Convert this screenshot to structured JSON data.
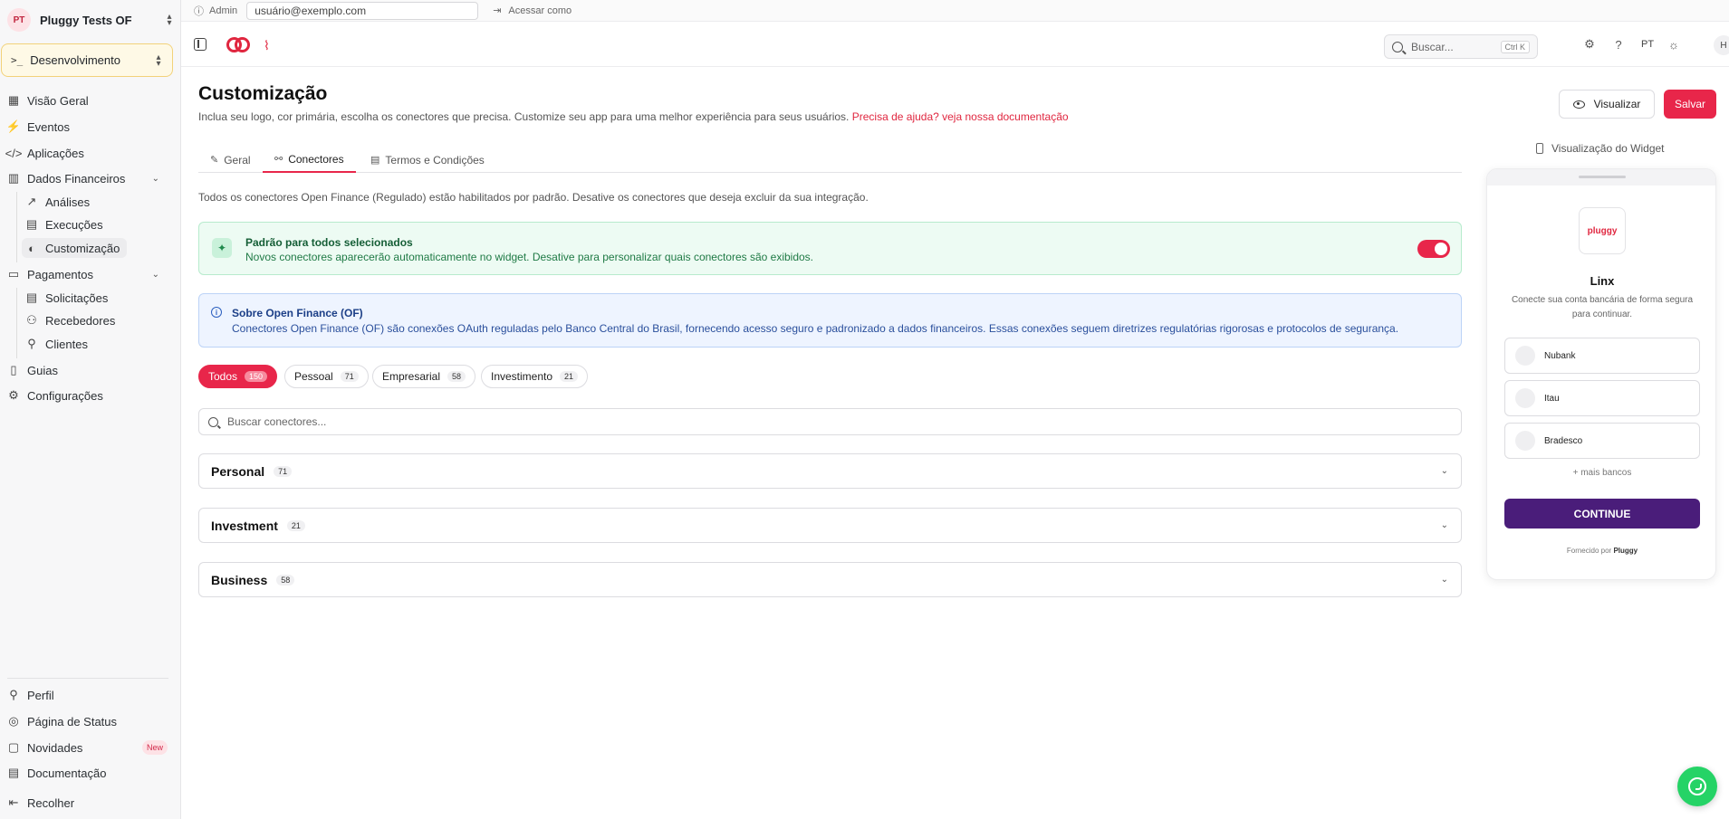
{
  "org": {
    "initials": "PT",
    "name": "Pluggy Tests OF"
  },
  "environment": {
    "prompt": ">_",
    "label": "Desenvolvimento"
  },
  "sidebar": {
    "items": [
      {
        "label": "Visão Geral"
      },
      {
        "label": "Eventos"
      },
      {
        "label": "Aplicações"
      },
      {
        "label": "Dados Financeiros"
      },
      {
        "label": "Análises"
      },
      {
        "label": "Execuções"
      },
      {
        "label": "Customização"
      },
      {
        "label": "Pagamentos"
      },
      {
        "label": "Solicitações"
      },
      {
        "label": "Recebedores"
      },
      {
        "label": "Clientes"
      },
      {
        "label": "Guias"
      },
      {
        "label": "Configurações"
      }
    ],
    "footer": [
      {
        "label": "Perfil"
      },
      {
        "label": "Página de Status"
      },
      {
        "label": "Novidades",
        "badge": "New"
      },
      {
        "label": "Documentação"
      },
      {
        "label": "Recolher"
      }
    ]
  },
  "topbar": {
    "admin_label": "Admin",
    "email_value": "usuário@exemplo.com",
    "impersonate_label": "Acessar como"
  },
  "header": {
    "search_placeholder": "Buscar...",
    "search_shortcut": "Ctrl K",
    "language": "PT",
    "user_initial": "H"
  },
  "page": {
    "title": "Customização",
    "subtitle": "Inclua seu logo, cor primária, escolha os conectores que precisa. Customize seu app para uma melhor experiência para seus usuários.",
    "help_link": "Precisa de ajuda? veja nossa documentação",
    "preview_button": "Visualizar",
    "save_button": "Salvar",
    "tabs": [
      {
        "label": "Geral"
      },
      {
        "label": "Conectores"
      },
      {
        "label": "Termos e Condições"
      }
    ],
    "info_line": "Todos os conectores Open Finance (Regulado) estão habilitados por padrão. Desative os conectores que deseja excluir da sua integração.",
    "default_card": {
      "title": "Padrão para todos selecionados",
      "text": "Novos conectores aparecerão automaticamente no widget. Desative para personalizar quais conectores são exibidos.",
      "toggle_on": true
    },
    "of_card": {
      "title": "Sobre Open Finance (OF)",
      "text": "Conectores Open Finance (OF) são conexões OAuth reguladas pelo Banco Central do Brasil, fornecendo acesso seguro e padronizado a dados financeiros. Essas conexões seguem diretrizes regulatórias rigorosas e protocolos de segurança."
    },
    "filters": [
      {
        "label": "Todos",
        "count": "150"
      },
      {
        "label": "Pessoal",
        "count": "71"
      },
      {
        "label": "Empresarial",
        "count": "58"
      },
      {
        "label": "Investimento",
        "count": "21"
      }
    ],
    "connector_search_placeholder": "Buscar conectores...",
    "groups": [
      {
        "label": "Personal",
        "count": "71"
      },
      {
        "label": "Investment",
        "count": "21"
      },
      {
        "label": "Business",
        "count": "58"
      }
    ]
  },
  "widget": {
    "label": "Visualização do Widget",
    "logo_text": "pluggy",
    "name": "Linx",
    "description": "Conecte sua conta bancária de forma segura para continuar.",
    "banks": [
      "Nubank",
      "Itau",
      "Bradesco"
    ],
    "more": "+ mais bancos",
    "continue": "CONTINUE",
    "powered_prefix": "Fornecido por",
    "powered_brand": "Pluggy"
  },
  "colors": {
    "accent": "#e8264a",
    "widget_button": "#4a1d7a",
    "whatsapp": "#25d366"
  }
}
